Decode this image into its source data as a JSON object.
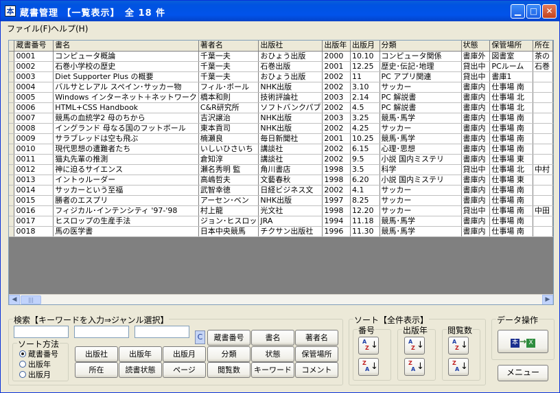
{
  "window": {
    "title": "蔵書管理 【一覧表示】　全 18 件",
    "icon_char": "本"
  },
  "menubar": [
    {
      "label": "ファイル(F)"
    },
    {
      "label": "ヘルプ(H)"
    }
  ],
  "table": {
    "columns": [
      "蔵書番号",
      "書名",
      "著者名",
      "出版社",
      "出版年",
      "出版月",
      "分類",
      "状態",
      "保管場所",
      "所在"
    ],
    "rows": [
      [
        "0001",
        "コンピュータ概論",
        "千葉一夫",
        "おひょう出版",
        "2000",
        "10.10",
        "コンピュータ関係",
        "書庫外",
        "図書室",
        "茶の"
      ],
      [
        "0002",
        "石巻小学校の歴史",
        "千葉一夫",
        "石巻出版",
        "2001",
        "12.25",
        "歴史･伝記･地理",
        "貸出中",
        "PCルーム",
        "石巻"
      ],
      [
        "0003",
        "Diet Supporter Plus の概要",
        "千葉一夫",
        "おひょう出版",
        "2002",
        "11",
        "PC アプリ関連",
        "貸出中",
        "書庫1",
        ""
      ],
      [
        "0004",
        "バルサとレアル スペイン･サッカー物",
        "フィル･ボール",
        "NHK出版",
        "2002",
        "3.10",
        "サッカー",
        "書庫内",
        "仕事場 南",
        ""
      ],
      [
        "0005",
        "Windows インターネット＋ネットワーク",
        "橋本和則",
        "技術評論社",
        "2003",
        "2.14",
        "PC 解説書",
        "書庫内",
        "仕事場 北",
        ""
      ],
      [
        "0006",
        "HTML+CSS Handbook",
        "C&R研究所",
        "ソフトバンクパブ",
        "2002",
        "4.5",
        "PC 解説書",
        "書庫内",
        "仕事場 北",
        ""
      ],
      [
        "0007",
        "競馬の血統学2 母のちから",
        "吉沢譲治",
        "NHK出版",
        "2003",
        "3.25",
        "競馬･馬学",
        "書庫内",
        "仕事場 南",
        ""
      ],
      [
        "0008",
        "イングランド 母なる国のフットボール",
        "東本貢司",
        "NHK出版",
        "2002",
        "4.25",
        "サッカー",
        "書庫内",
        "仕事場 南",
        ""
      ],
      [
        "0009",
        "サラブレッドは空も飛ぶ",
        "楠瀬良",
        "毎日新聞社",
        "2001",
        "10.25",
        "競馬･馬学",
        "書庫内",
        "仕事場 南",
        ""
      ],
      [
        "0010",
        "現代思想の遭難者たち",
        "いしいひさいち",
        "講談社",
        "2002",
        "6.15",
        "心理･思想",
        "書庫内",
        "仕事場 南",
        ""
      ],
      [
        "0011",
        "猫丸先輩の推測",
        "倉知淳",
        "講談社",
        "2002",
        "9.5",
        "小説 国内ミステリ",
        "書庫内",
        "仕事場 東",
        ""
      ],
      [
        "0012",
        "神に迫るサイエンス",
        "瀬名秀明 監",
        "角川書店",
        "1998",
        "3.5",
        "科学",
        "貸出中",
        "仕事場 北",
        "中村"
      ],
      [
        "0013",
        "イントゥルーダー",
        "高嶋哲夫",
        "文藝春秋",
        "1998",
        "6.20",
        "小説 国内ミステリ",
        "書庫内",
        "仕事場 東",
        ""
      ],
      [
        "0014",
        "サッカーという至福",
        "武智幸徳",
        "日経ビジネス文",
        "2002",
        "4.1",
        "サッカー",
        "書庫内",
        "仕事場 南",
        ""
      ],
      [
        "0015",
        "勝者のエスプリ",
        "アーセン･ベン",
        "NHK出版",
        "1997",
        "8.25",
        "サッカー",
        "書庫内",
        "仕事場 南",
        ""
      ],
      [
        "0016",
        "フィジカル･インテンシティ '97-'98",
        "村上龍",
        "光文社",
        "1998",
        "12.20",
        "サッカー",
        "貸出中",
        "仕事場 南",
        "中田"
      ],
      [
        "0017",
        "ヒスロップの生産手法",
        "ジョン･ヒスロッ",
        "JRA",
        "1994",
        "11.18",
        "競馬･馬学",
        "書庫内",
        "仕事場 南",
        ""
      ],
      [
        "0018",
        "馬の医学書",
        "日本中央競馬",
        "チクサン出版社",
        "1996",
        "11.30",
        "競馬･馬学",
        "書庫内",
        "仕事場 南",
        ""
      ]
    ]
  },
  "search": {
    "label": "検索【キーワードを入力⇒ジャンル選択】",
    "keyword1": "",
    "keyword2": "",
    "keyword3": "",
    "clear_label": "C",
    "genre_buttons_row1": [
      "蔵書番号",
      "書名",
      "著者名"
    ],
    "genre_buttons_row2": [
      "出版社",
      "出版年",
      "出版月",
      "分類",
      "状態",
      "保管場所"
    ],
    "genre_buttons_row3": [
      "所在",
      "読書状態",
      "ページ",
      "閲覧数",
      "キーワード",
      "コメント"
    ]
  },
  "sort_method": {
    "label": "ソート方法",
    "options": [
      "蔵書番号",
      "出版年",
      "出版月"
    ],
    "selected": "蔵書番号"
  },
  "sort_all": {
    "label": "ソート【全件表示】",
    "groups": [
      "番号",
      "出版年",
      "閲覧数"
    ],
    "asc_top": "A",
    "asc_bot": "Z",
    "desc_top": "Z",
    "desc_bot": "A"
  },
  "data_ops": {
    "label": "データ操作",
    "export_icon_left": "本",
    "export_icon_right": "X",
    "menu_label": "メニュー"
  }
}
